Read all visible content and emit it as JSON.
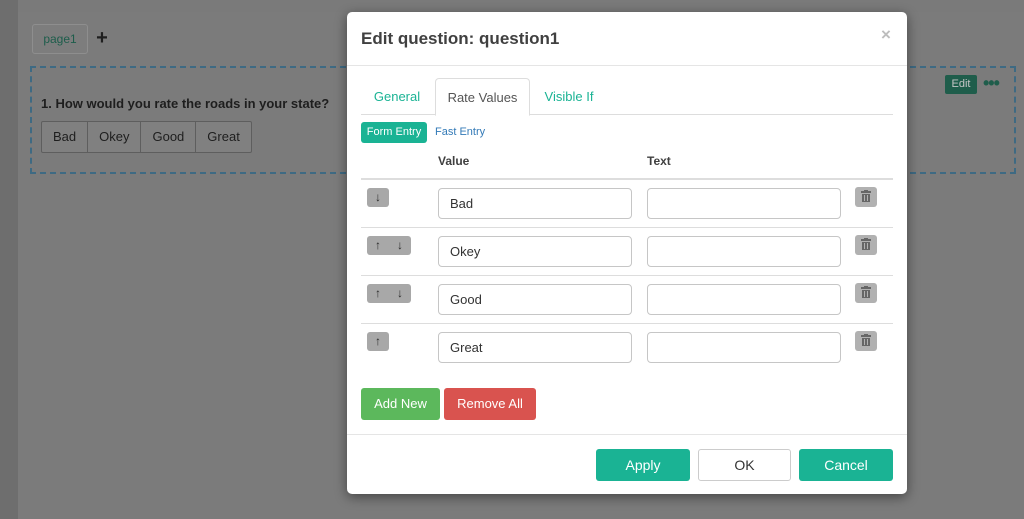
{
  "editor": {
    "page_tab": "page1",
    "add_page_icon": "+",
    "question_title": "1. How would you rate the roads in your state?",
    "rate_values": [
      "Bad",
      "Okey",
      "Good",
      "Great"
    ],
    "edit_badge": "Edit",
    "more_icon": "•••"
  },
  "modal": {
    "title": "Edit question: question1",
    "close_icon": "×",
    "tabs": [
      {
        "label": "General",
        "active": false
      },
      {
        "label": "Rate Values",
        "active": true
      },
      {
        "label": "Visible If",
        "active": false
      }
    ],
    "entry_modes": {
      "form": "Form Entry",
      "fast": "Fast Entry",
      "selected": "form"
    },
    "columns": {
      "value": "Value",
      "text": "Text"
    },
    "rows": [
      {
        "value": "Bad",
        "text": "",
        "arrows": [
          "down"
        ]
      },
      {
        "value": "Okey",
        "text": "",
        "arrows": [
          "up",
          "down"
        ]
      },
      {
        "value": "Good",
        "text": "",
        "arrows": [
          "up",
          "down"
        ]
      },
      {
        "value": "Great",
        "text": "",
        "arrows": [
          "up"
        ]
      }
    ],
    "add_new": "Add New",
    "remove_all": "Remove All",
    "footer": {
      "apply": "Apply",
      "ok": "OK",
      "cancel": "Cancel"
    }
  },
  "colors": {
    "accent": "#1ab394",
    "success": "#5cb85c",
    "danger": "#d9534f",
    "link": "#337ab7"
  }
}
